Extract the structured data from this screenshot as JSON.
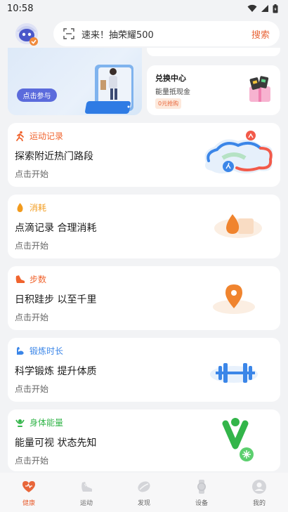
{
  "status_bar": {
    "time": "10:58"
  },
  "search": {
    "text": "速来！抽荣耀500",
    "button": "搜索"
  },
  "promo": {
    "join_label": "点击参与",
    "exchange_title": "兑换中心",
    "exchange_subtitle": "能量抵现金",
    "exchange_tag": "0元抢购"
  },
  "cards": [
    {
      "category": "运动记录",
      "title": "探索附近热门路段",
      "action": "点击开始",
      "color": "#f0642e"
    },
    {
      "category": "消耗",
      "title": "点滴记录 合理消耗",
      "action": "点击开始",
      "color": "#f29b1d"
    },
    {
      "category": "步数",
      "title": "日积跬步 以至千里",
      "action": "点击开始",
      "color": "#f0642e"
    },
    {
      "category": "锻炼时长",
      "title": "科学锻炼 提升体质",
      "action": "点击开始",
      "color": "#3b86e8"
    },
    {
      "category": "身体能量",
      "title": "能量可视 状态先知",
      "action": "点击开始",
      "color": "#33b54a"
    }
  ],
  "nav": [
    {
      "label": "健康",
      "active": true
    },
    {
      "label": "运动",
      "active": false
    },
    {
      "label": "发现",
      "active": false
    },
    {
      "label": "设备",
      "active": false
    },
    {
      "label": "我的",
      "active": false
    }
  ],
  "colors": {
    "accent": "#e8663a",
    "background": "#f2f3f5"
  }
}
